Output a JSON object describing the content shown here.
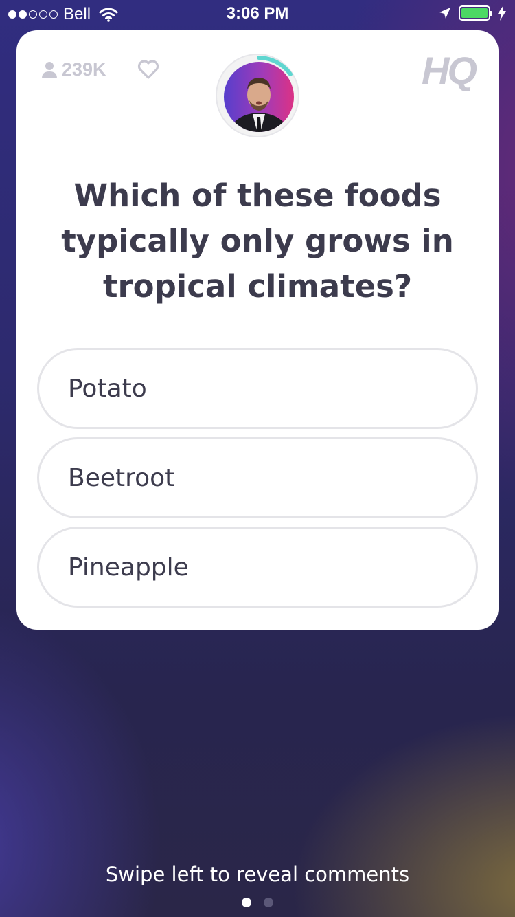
{
  "status_bar": {
    "carrier": "Bell",
    "time": "3:06 PM",
    "signal_bars_filled": 2,
    "signal_bars_total": 5,
    "battery_color": "#4cd964"
  },
  "card": {
    "viewer_count": "239K",
    "logo_text": "HQ",
    "question": "Which of these foods typically only grows in tropical climates?",
    "answers": [
      {
        "label": "Potato"
      },
      {
        "label": "Beetroot"
      },
      {
        "label": "Pineapple"
      }
    ],
    "timer_color": "#5fd6d0"
  },
  "footer": {
    "swipe_hint": "Swipe left to reveal comments",
    "pages_total": 2,
    "active_page": 1
  },
  "icons": [
    "wifi-icon",
    "location-icon",
    "battery-icon",
    "bolt-icon",
    "person-icon",
    "heart-icon"
  ]
}
